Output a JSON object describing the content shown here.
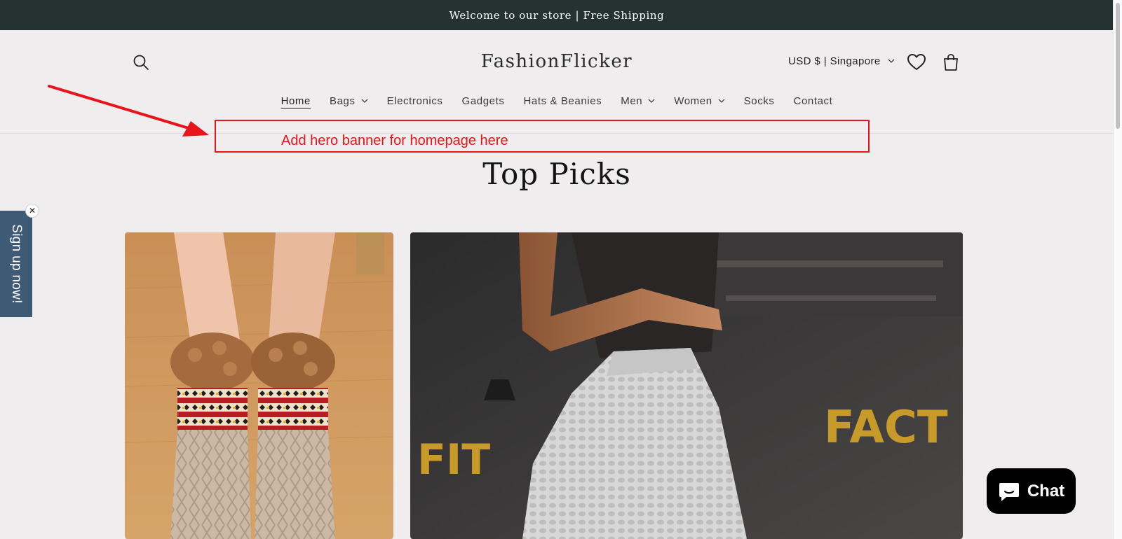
{
  "announcement": {
    "text": "Welcome to our store | Free Shipping"
  },
  "header": {
    "logo": "FashionFlicker",
    "currency": "USD $ | Singapore",
    "icons": {
      "search": "search-icon",
      "wishlist": "heart-icon",
      "cart": "cart-icon"
    }
  },
  "nav": {
    "items": [
      {
        "label": "Home",
        "active": true,
        "dropdown": false
      },
      {
        "label": "Bags",
        "dropdown": true
      },
      {
        "label": "Electronics",
        "dropdown": false
      },
      {
        "label": "Gadgets",
        "dropdown": false
      },
      {
        "label": "Hats & Beanies",
        "dropdown": false
      },
      {
        "label": "Men",
        "dropdown": true
      },
      {
        "label": "Women",
        "dropdown": true
      },
      {
        "label": "Socks",
        "dropdown": false
      },
      {
        "label": "Contact",
        "dropdown": false
      }
    ]
  },
  "annotation": {
    "text": "Add hero banner for homepage here",
    "color": "#e8141a"
  },
  "section": {
    "title": "Top Picks"
  },
  "signup": {
    "label": "Sign up now!",
    "close": "✕"
  },
  "chat": {
    "label": "Chat"
  },
  "colors": {
    "announcement_bg": "#243232",
    "page_bg": "#efedee",
    "signup_bg": "#3e5a74",
    "annotation": "#e8141a"
  }
}
